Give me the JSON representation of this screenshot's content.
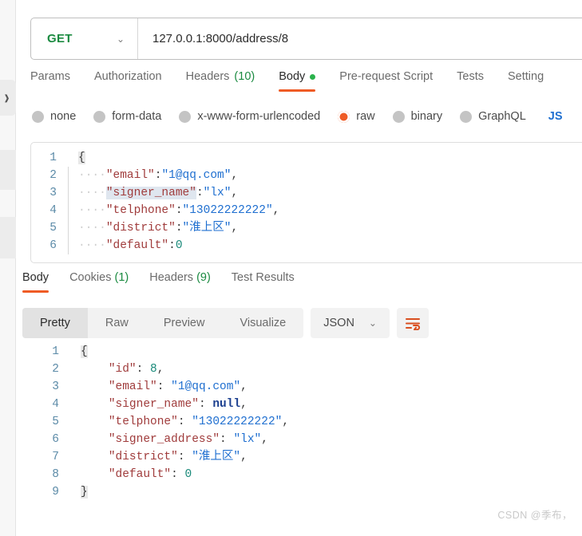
{
  "left_rail": {
    "handle_icon": "chevron-right-icon"
  },
  "request": {
    "method": "GET",
    "method_caret_icon": "chevron-down-icon",
    "url": "127.0.0.1:8000/address/8",
    "tabs": [
      {
        "label": "Params",
        "active": false
      },
      {
        "label": "Authorization",
        "active": false
      },
      {
        "label": "Headers",
        "count": "(10)",
        "active": false
      },
      {
        "label": "Body",
        "active": true,
        "dot": true
      },
      {
        "label": "Pre-request Script",
        "active": false
      },
      {
        "label": "Tests",
        "active": false
      },
      {
        "label": "Setting",
        "active": false
      }
    ],
    "body_types": [
      {
        "label": "none",
        "checked": false
      },
      {
        "label": "form-data",
        "checked": false
      },
      {
        "label": "x-www-form-urlencoded",
        "checked": false
      },
      {
        "label": "raw",
        "checked": true
      },
      {
        "label": "binary",
        "checked": false
      },
      {
        "label": "GraphQL",
        "checked": false
      }
    ],
    "format_label": "JS",
    "body_lines": [
      {
        "num": "1",
        "brace": "{"
      },
      {
        "num": "2",
        "ws": "····",
        "key": "\"email\"",
        "colon": ":",
        "value": "\"1@qq.com\"",
        "value_type": "s",
        "tail": ","
      },
      {
        "num": "3",
        "ws": "····",
        "key": "\"signer_name\"",
        "key_selected": true,
        "colon": ":",
        "value": "\"lx\"",
        "value_type": "s",
        "tail": ","
      },
      {
        "num": "4",
        "ws": "····",
        "key": "\"telphone\"",
        "colon": ":",
        "value": "\"13022222222\"",
        "value_type": "s",
        "tail": ","
      },
      {
        "num": "5",
        "ws": "····",
        "key": "\"district\"",
        "colon": ":",
        "value": "\"淮上区\"",
        "value_type": "s",
        "tail": ","
      },
      {
        "num": "6",
        "ws": "····",
        "key": "\"default\"",
        "colon": ":",
        "value": "0",
        "value_type": "n",
        "tail": ""
      }
    ]
  },
  "response": {
    "tabs": [
      {
        "label": "Body",
        "active": true
      },
      {
        "label": "Cookies",
        "count": "(1)",
        "active": false
      },
      {
        "label": "Headers",
        "count": "(9)",
        "active": false
      },
      {
        "label": "Test Results",
        "active": false
      }
    ],
    "views": [
      {
        "label": "Pretty",
        "active": true
      },
      {
        "label": "Raw",
        "active": false
      },
      {
        "label": "Preview",
        "active": false
      },
      {
        "label": "Visualize",
        "active": false
      }
    ],
    "format": "JSON",
    "format_caret_icon": "chevron-down-icon",
    "wrap_icon": "word-wrap-icon",
    "body_lines": [
      {
        "num": "1",
        "brace": "{"
      },
      {
        "num": "2",
        "indent": "    ",
        "key": "\"id\"",
        "colon": ": ",
        "value": "8",
        "value_type": "n",
        "tail": ","
      },
      {
        "num": "3",
        "indent": "    ",
        "key": "\"email\"",
        "colon": ": ",
        "value": "\"1@qq.com\"",
        "value_type": "s",
        "tail": ","
      },
      {
        "num": "4",
        "indent": "    ",
        "key": "\"signer_name\"",
        "colon": ": ",
        "value": "null",
        "value_type": "nullv",
        "tail": ","
      },
      {
        "num": "5",
        "indent": "    ",
        "key": "\"telphone\"",
        "colon": ": ",
        "value": "\"13022222222\"",
        "value_type": "s",
        "tail": ","
      },
      {
        "num": "6",
        "indent": "    ",
        "key": "\"signer_address\"",
        "colon": ": ",
        "value": "\"lx\"",
        "value_type": "s",
        "tail": ","
      },
      {
        "num": "7",
        "indent": "    ",
        "key": "\"district\"",
        "colon": ": ",
        "value": "\"淮上区\"",
        "value_type": "s",
        "tail": ","
      },
      {
        "num": "8",
        "indent": "    ",
        "key": "\"default\"",
        "colon": ": ",
        "value": "0",
        "value_type": "n",
        "tail": ""
      },
      {
        "num": "9",
        "brace": "}"
      }
    ]
  },
  "watermark": "CSDN @季布，",
  "colors": {
    "accent_orange": "#ef5b25",
    "method_green": "#1a8a40",
    "count_green": "#1a8a40",
    "string_blue": "#1f6fd0",
    "key_maroon": "#a03c3c",
    "number_teal": "#1a8a7a"
  }
}
